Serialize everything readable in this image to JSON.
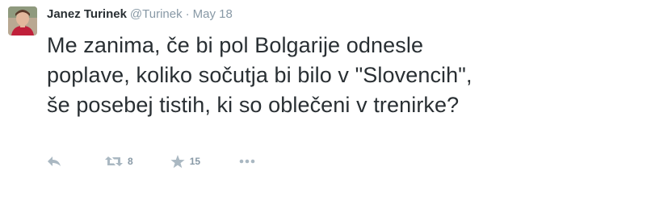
{
  "tweet": {
    "fullname": "Janez Turinek",
    "username": "@Turinek",
    "separator": "·",
    "time": "May 18",
    "text_lines": [
      "Me zanima, če bi pol Bolgarije odnesle",
      "poplave, koliko sočutja bi bilo v \"Slovencih\",",
      "še posebej tistih, ki so oblečeni v trenirke?"
    ]
  },
  "actions": {
    "retweet_count": "8",
    "favorite_count": "15"
  },
  "icons": {
    "reply": "reply-icon",
    "retweet": "retweet-icon",
    "favorite": "star-icon",
    "more": "more-dots-icon"
  },
  "colors": {
    "text": "#292f33",
    "muted": "#8899a6",
    "icon": "#aab8c2"
  }
}
